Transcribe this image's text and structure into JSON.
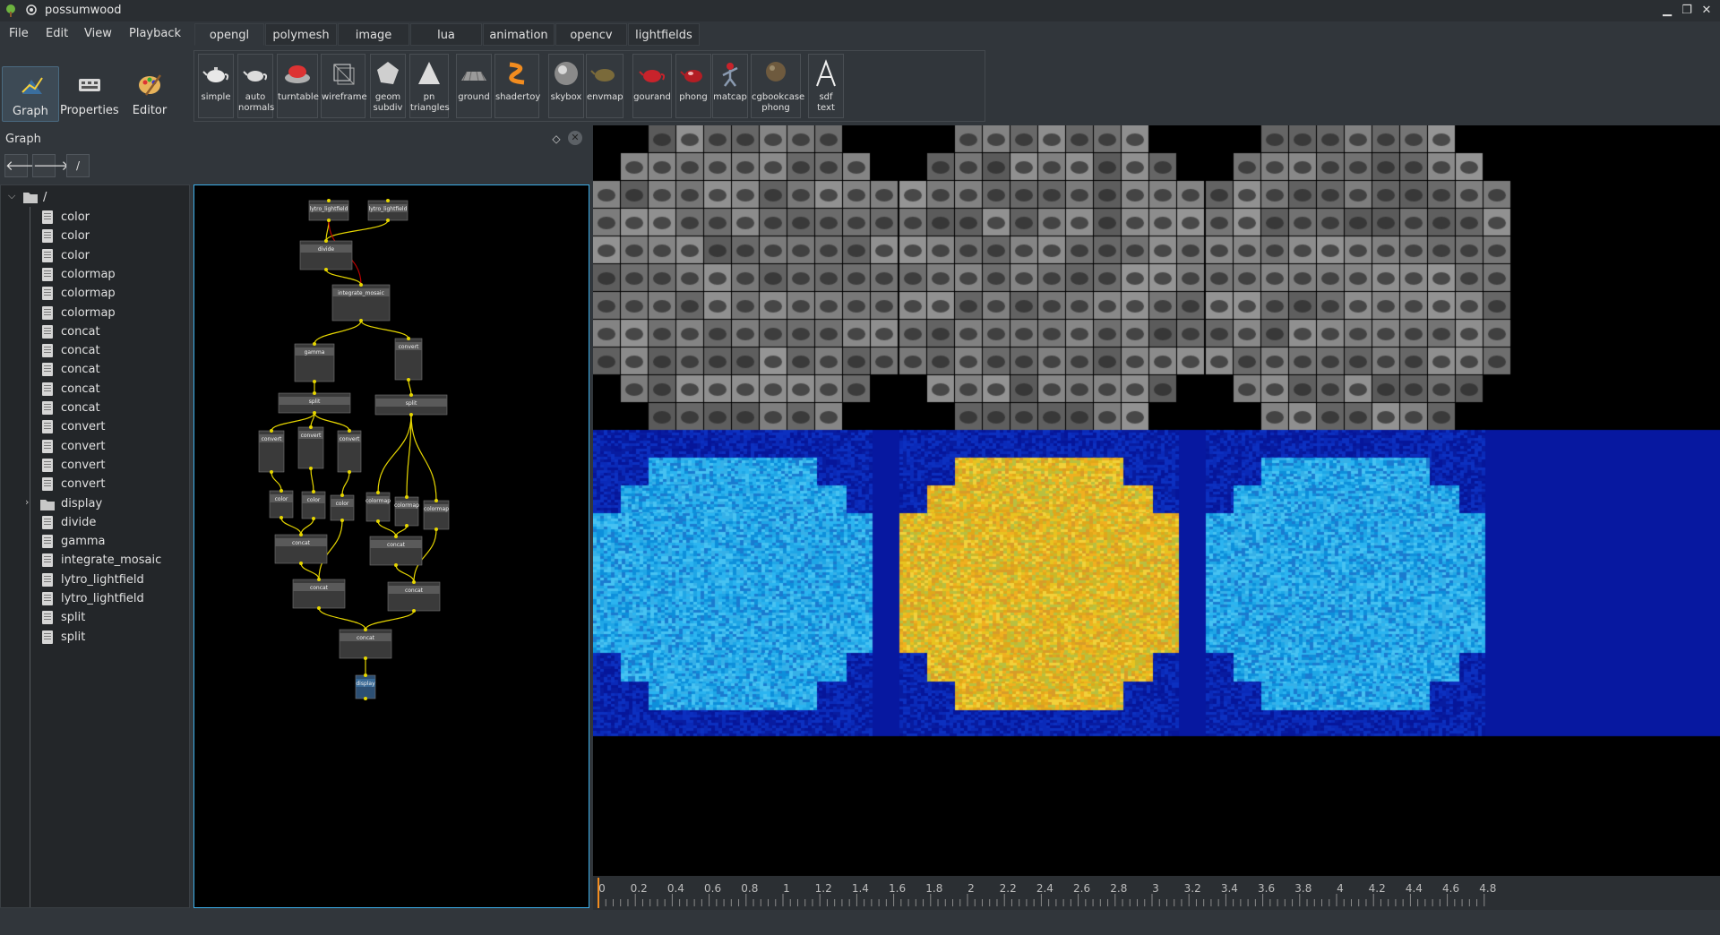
{
  "window": {
    "title": "possumwood",
    "controls": [
      "minimize",
      "maximize",
      "close"
    ]
  },
  "menu": [
    "File",
    "Edit",
    "View",
    "Playback"
  ],
  "tabs": [
    "opengl",
    "polymesh",
    "image",
    "lua",
    "animation",
    "opencv",
    "lightfields"
  ],
  "active_tab": "opengl",
  "side_buttons": [
    {
      "label": "Graph",
      "icon": "graph-icon",
      "active": true
    },
    {
      "label": "Properties",
      "icon": "properties-icon",
      "active": false
    },
    {
      "label": "Editor",
      "icon": "editor-icon",
      "active": false
    }
  ],
  "toolbar_items": [
    {
      "label": "simple",
      "icon": "teapot-icon"
    },
    {
      "label": "auto\nnormals",
      "icon": "teapot-normals-icon"
    },
    {
      "label": "turntable",
      "icon": "turntable-icon"
    },
    {
      "label": "wireframe",
      "icon": "wireframe-icon"
    },
    {
      "label": "geom\nsubdiv",
      "icon": "geom-subdiv-icon"
    },
    {
      "label": "pn\ntriangles",
      "icon": "pn-triangles-icon"
    },
    {
      "label": "ground",
      "icon": "ground-icon"
    },
    {
      "label": "shadertoy",
      "icon": "shadertoy-icon"
    },
    {
      "label": "skybox",
      "icon": "skybox-icon"
    },
    {
      "label": "envmap",
      "icon": "envmap-icon"
    },
    {
      "label": "gourand",
      "icon": "gourand-icon"
    },
    {
      "label": "phong",
      "icon": "phong-icon"
    },
    {
      "label": "matcap",
      "icon": "matcap-icon"
    },
    {
      "label": "cgbookcase\nphong",
      "icon": "cgbookcase-icon"
    },
    {
      "label": "sdf\ntext",
      "icon": "sdf-text-icon"
    }
  ],
  "graph_panel": {
    "title": "Graph",
    "path": "/",
    "root": "/",
    "tree": [
      "color",
      "color",
      "color",
      "colormap",
      "colormap",
      "colormap",
      "concat",
      "concat",
      "concat",
      "concat",
      "concat",
      "convert",
      "convert",
      "convert",
      "convert",
      "display",
      "divide",
      "gamma",
      "integrate_mosaic",
      "lytro_lightfield",
      "lytro_lightfield",
      "split",
      "split"
    ],
    "folder_item": "display"
  },
  "nodes": [
    {
      "id": "n1",
      "title": "lytro_lightfield"
    },
    {
      "id": "n2",
      "title": "lytro_lightfield"
    },
    {
      "id": "n3",
      "title": "divide"
    },
    {
      "id": "n4",
      "title": "integrate_mosaic"
    },
    {
      "id": "n5",
      "title": "gamma"
    },
    {
      "id": "n6",
      "title": "convert"
    },
    {
      "id": "n7",
      "title": "split"
    },
    {
      "id": "n8",
      "title": "split"
    },
    {
      "id": "n9",
      "title": "convert"
    },
    {
      "id": "n10",
      "title": "convert"
    },
    {
      "id": "n11",
      "title": "convert"
    },
    {
      "id": "n12",
      "title": "color"
    },
    {
      "id": "n13",
      "title": "color"
    },
    {
      "id": "n14",
      "title": "color"
    },
    {
      "id": "n15",
      "title": "colormap"
    },
    {
      "id": "n16",
      "title": "colormap"
    },
    {
      "id": "n17",
      "title": "colormap"
    },
    {
      "id": "n18",
      "title": "concat"
    },
    {
      "id": "n19",
      "title": "concat"
    },
    {
      "id": "n20",
      "title": "concat"
    },
    {
      "id": "n21",
      "title": "concat"
    },
    {
      "id": "n22",
      "title": "concat"
    },
    {
      "id": "n23",
      "title": "display"
    }
  ],
  "timeline": {
    "ticks": [
      "0",
      "0.2",
      "0.4",
      "0.6",
      "0.8",
      "1",
      "1.2",
      "1.4",
      "1.6",
      "1.8",
      "2",
      "2.2",
      "2.4",
      "2.6",
      "2.8",
      "3",
      "3.2",
      "3.4",
      "3.6",
      "3.8",
      "4",
      "4.2",
      "4.4",
      "4.6",
      "4.8"
    ],
    "current": "0"
  },
  "colors": {
    "accent": "#3daee9",
    "connection": "#e6d600",
    "connection_alt": "#c00000",
    "timeline_marker": "#f28c1f"
  }
}
